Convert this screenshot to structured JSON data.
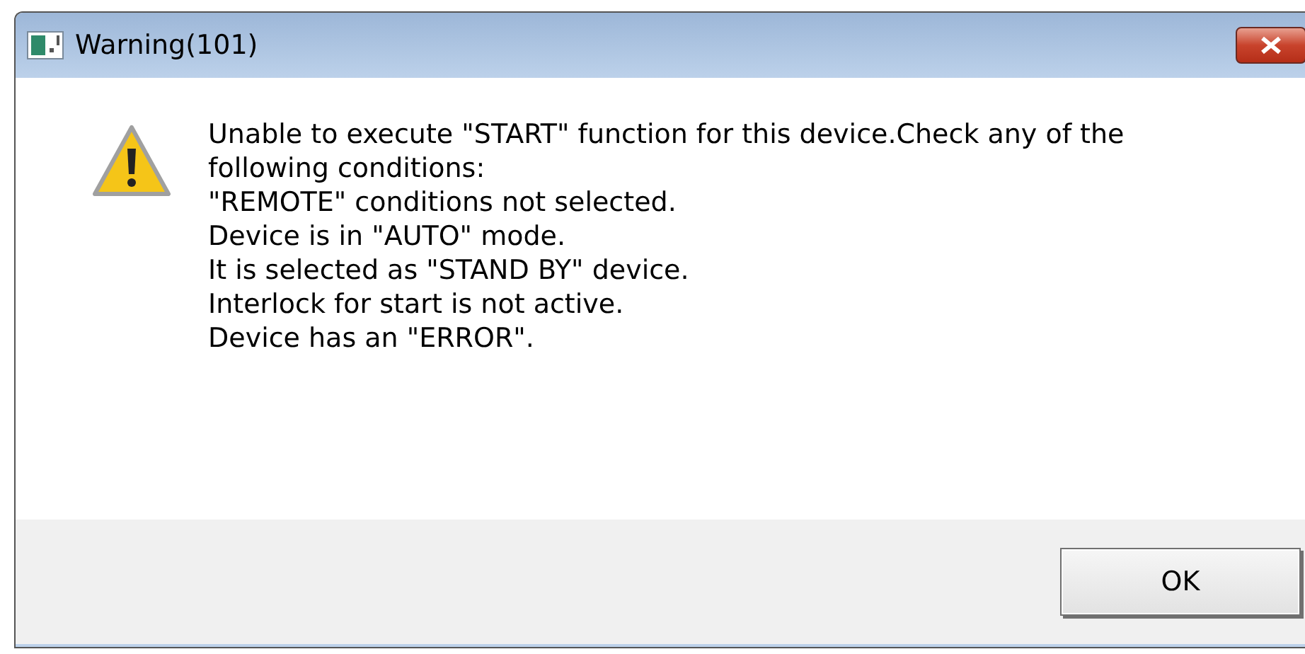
{
  "window": {
    "title": "Warning(101)"
  },
  "message_lines": [
    "Unable to execute \"START\" function for this device.Check any of the",
    "following conditions:",
    "\"REMOTE\" conditions not selected.",
    "Device is in \"AUTO\" mode.",
    "It is selected as \"STAND BY\" device.",
    "Interlock for start is not active.",
    "Device has an \"ERROR\"."
  ],
  "buttons": [
    "OK"
  ]
}
